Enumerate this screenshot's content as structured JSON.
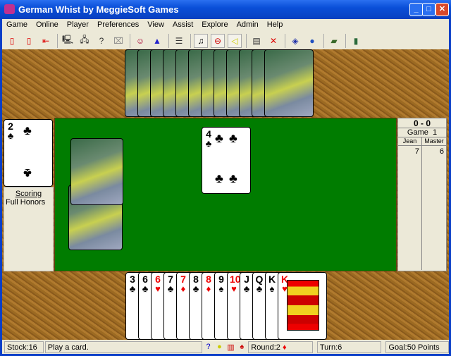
{
  "window": {
    "title": "German Whist by MeggieSoft Games"
  },
  "menu": [
    "Game",
    "Online",
    "Player",
    "Preferences",
    "View",
    "Assist",
    "Explore",
    "Admin",
    "Help"
  ],
  "toolbar": [
    {
      "icon": "new-game-icon",
      "glyph": "▯",
      "color": "#d00"
    },
    {
      "icon": "deal-icon",
      "glyph": "▯",
      "color": "#d00"
    },
    {
      "icon": "undo-card-icon",
      "glyph": "⇤",
      "color": "#d00"
    },
    {
      "sep": true
    },
    {
      "icon": "connect-icon",
      "glyph": "🖳",
      "color": "#333"
    },
    {
      "icon": "network-icon",
      "glyph": "🖧",
      "color": "#333"
    },
    {
      "icon": "network-query-icon",
      "glyph": "?",
      "color": "#333"
    },
    {
      "icon": "disconnect-icon",
      "glyph": "⌧",
      "color": "#888"
    },
    {
      "sep": true
    },
    {
      "icon": "player-icon",
      "glyph": "☺",
      "color": "#a03"
    },
    {
      "icon": "wizard-icon",
      "glyph": "▲",
      "color": "#22c"
    },
    {
      "sep": true
    },
    {
      "icon": "preferences-icon",
      "glyph": "☰",
      "color": "#333"
    },
    {
      "sep": true
    },
    {
      "icon": "music-icon",
      "glyph": "♫",
      "color": "#000",
      "pressed": true
    },
    {
      "icon": "speech-icon",
      "glyph": "⊖",
      "color": "#c00",
      "pressed": true
    },
    {
      "icon": "sound-icon",
      "glyph": "◁",
      "color": "#cc0",
      "pressed": true
    },
    {
      "sep": true
    },
    {
      "icon": "robot-icon",
      "glyph": "▤",
      "color": "#333"
    },
    {
      "icon": "robot-off-icon",
      "glyph": "✕",
      "color": "#d00"
    },
    {
      "sep": true
    },
    {
      "icon": "explore-icon",
      "glyph": "◈",
      "color": "#23a"
    },
    {
      "icon": "globe-icon",
      "glyph": "●",
      "color": "#2050c0"
    },
    {
      "sep": true
    },
    {
      "icon": "help-book-icon",
      "glyph": "▰",
      "color": "#3a6a2a"
    },
    {
      "sep": true
    },
    {
      "icon": "exit-icon",
      "glyph": "▮",
      "color": "#2a6a3a"
    }
  ],
  "upcard": {
    "rank": "2",
    "suit": "♣",
    "color": "black"
  },
  "scoring": {
    "label": "Scoring",
    "value": "Full Honors"
  },
  "score": {
    "match": "0 - 0",
    "game": "Game  1",
    "players": [
      "Jean",
      "Master"
    ],
    "points": [
      "7",
      "6"
    ]
  },
  "trick_card": {
    "rank": "4",
    "suit": "♣",
    "color": "black"
  },
  "opponent_cards": 12,
  "hand": [
    {
      "rank": "3",
      "suit": "♣",
      "color": "black"
    },
    {
      "rank": "6",
      "suit": "♣",
      "color": "black"
    },
    {
      "rank": "6",
      "suit": "♥",
      "color": "red"
    },
    {
      "rank": "7",
      "suit": "♣",
      "color": "black"
    },
    {
      "rank": "7",
      "suit": "♦",
      "color": "red"
    },
    {
      "rank": "8",
      "suit": "♣",
      "color": "black"
    },
    {
      "rank": "8",
      "suit": "♦",
      "color": "red"
    },
    {
      "rank": "9",
      "suit": "♠",
      "color": "black"
    },
    {
      "rank": "10",
      "suit": "♥",
      "color": "red"
    },
    {
      "rank": "J",
      "suit": "♣",
      "color": "black"
    },
    {
      "rank": "Q",
      "suit": "♣",
      "color": "black"
    },
    {
      "rank": "K",
      "suit": "♠",
      "color": "black"
    },
    {
      "rank": "K",
      "suit": "♥",
      "color": "red"
    }
  ],
  "status": {
    "stock": "Stock:16",
    "message": "Play a card.",
    "round": "Round:2",
    "round_suit": "♦",
    "turn": "Turn:6",
    "goal": "Goal:50 Points"
  }
}
